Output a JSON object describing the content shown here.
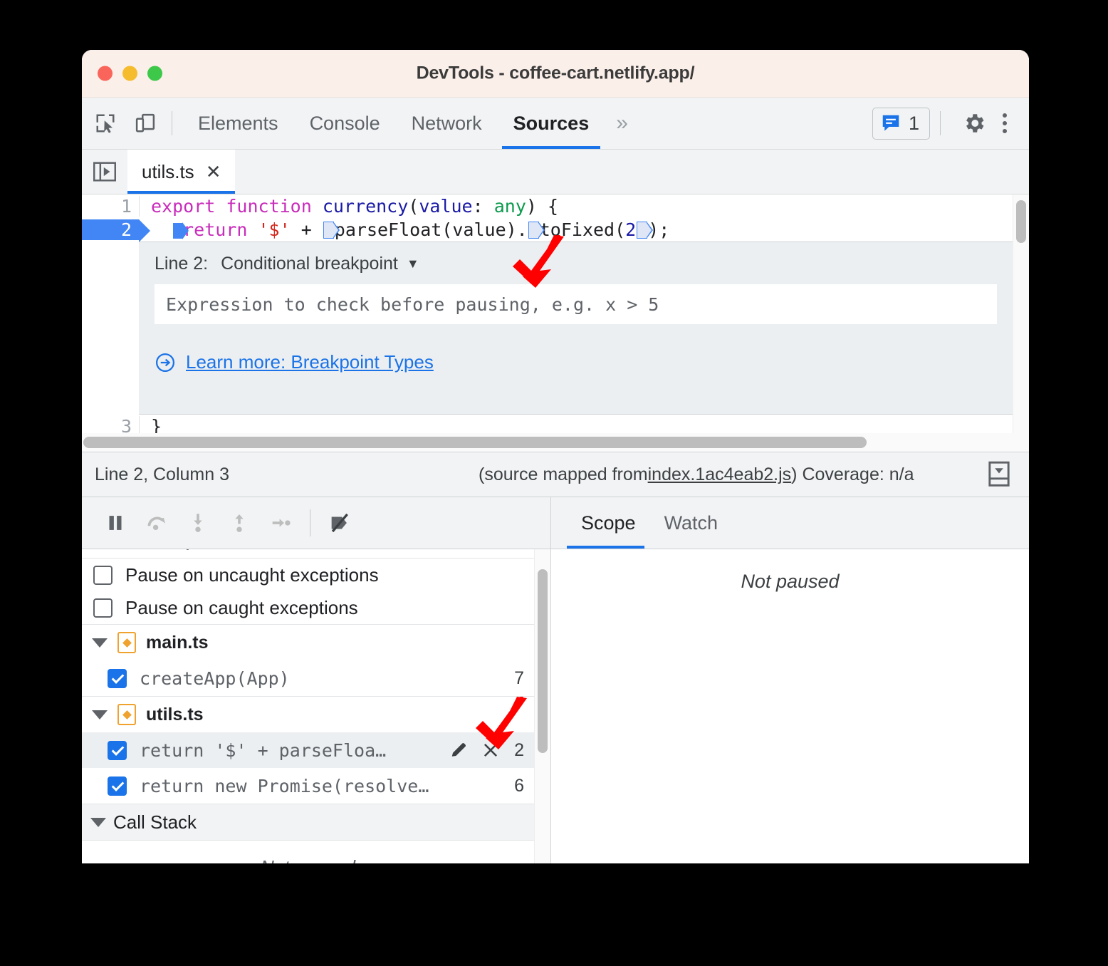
{
  "window": {
    "title": "DevTools - coffee-cart.netlify.app/",
    "traffic_lights": [
      "close",
      "minimize",
      "maximize"
    ]
  },
  "toolbar": {
    "inspect_icon": "inspect-element-icon",
    "device_icon": "device-toolbar-icon",
    "panels": [
      {
        "label": "Elements",
        "active": false
      },
      {
        "label": "Console",
        "active": false
      },
      {
        "label": "Network",
        "active": false
      },
      {
        "label": "Sources",
        "active": true
      }
    ],
    "more_panels": "»",
    "issues_count": "1",
    "issues_icon": "issues-message-icon",
    "settings_icon": "gear-icon",
    "kebab_icon": "more-options-icon"
  },
  "source_tabs": {
    "navigator_toggle_icon": "show-navigator-icon",
    "open_file": "utils.ts",
    "close_label": "✕"
  },
  "editor": {
    "lines": [
      {
        "number": "1",
        "breakpoint": false,
        "tokens": [
          {
            "t": "export",
            "c": "kw"
          },
          {
            "t": " ",
            "c": "plain"
          },
          {
            "t": "function",
            "c": "kw"
          },
          {
            "t": " ",
            "c": "plain"
          },
          {
            "t": "currency",
            "c": "fn"
          },
          {
            "t": "(",
            "c": "plain"
          },
          {
            "t": "value",
            "c": "param"
          },
          {
            "t": ": ",
            "c": "plain"
          },
          {
            "t": "any",
            "c": "type"
          },
          {
            "t": ") {",
            "c": "plain"
          }
        ]
      },
      {
        "number": "2",
        "breakpoint": true,
        "tokens": [
          {
            "t": "  ",
            "c": "plain"
          },
          {
            "t": "▸SOLID",
            "c": "bp-solid"
          },
          {
            "t": "return",
            "c": "kw"
          },
          {
            "t": " ",
            "c": "plain"
          },
          {
            "t": "'$'",
            "c": "str"
          },
          {
            "t": " + ",
            "c": "plain"
          },
          {
            "t": "▸HOLLOW",
            "c": "bp-hollow"
          },
          {
            "t": "parseFloat",
            "c": "plain"
          },
          {
            "t": "(value).",
            "c": "plain"
          },
          {
            "t": "▸HOLLOW",
            "c": "bp-hollow"
          },
          {
            "t": "toFixed",
            "c": "plain"
          },
          {
            "t": "(",
            "c": "plain"
          },
          {
            "t": "2",
            "c": "num"
          },
          {
            "t": "▸HOLLOW",
            "c": "bp-hollow"
          },
          {
            "t": ");",
            "c": "plain"
          }
        ]
      },
      {
        "number": "3",
        "breakpoint": false,
        "tokens": [
          {
            "t": "}",
            "c": "plain"
          }
        ]
      }
    ]
  },
  "breakpoint_editor": {
    "line_label": "Line 2:",
    "type_label": "Conditional breakpoint",
    "type_caret": "▼",
    "input_placeholder": "Expression to check before pausing, e.g. x > 5",
    "input_value": "",
    "learn_more_icon": "external-link-arrow-icon",
    "learn_more_label": "Learn more: Breakpoint Types"
  },
  "statusbar": {
    "position": "Line 2, Column 3",
    "source_mapped_prefix": "(source mapped from ",
    "source_mapped_file": "index.1ac4eab2.js",
    "source_mapped_suffix": ")",
    "coverage": "Coverage: n/a",
    "drawer_icon": "show-drawer-icon"
  },
  "debug_toolbar": {
    "buttons": [
      {
        "name": "pause-script-execution",
        "icon": "pause-icon"
      },
      {
        "name": "step-over-next-function-call",
        "icon": "step-over-icon"
      },
      {
        "name": "step-into-next-function-call",
        "icon": "step-into-icon"
      },
      {
        "name": "step-out-of-current-function",
        "icon": "step-out-icon"
      },
      {
        "name": "step",
        "icon": "step-icon"
      },
      {
        "name": "deactivate-breakpoints",
        "icon": "deactivate-breakpoints-icon"
      }
    ]
  },
  "breakpoints_pane": {
    "pause_options": [
      {
        "label": "Pause on uncaught exceptions",
        "checked": false
      },
      {
        "label": "Pause on caught exceptions",
        "checked": false
      }
    ],
    "groups": [
      {
        "file": "main.ts",
        "expanded": true,
        "items": [
          {
            "snippet": "createApp(App)",
            "line": "7",
            "checked": true,
            "selected": false,
            "actions": []
          }
        ]
      },
      {
        "file": "utils.ts",
        "expanded": true,
        "items": [
          {
            "snippet": "return '$' + parseFloa…",
            "line": "2",
            "checked": true,
            "selected": true,
            "actions": [
              "edit-breakpoint-icon",
              "remove-breakpoint-icon"
            ]
          },
          {
            "snippet": "return new Promise(resolve…",
            "line": "6",
            "checked": true,
            "selected": false,
            "actions": []
          }
        ]
      }
    ],
    "call_stack": {
      "title": "Call Stack",
      "expanded": true,
      "empty_text": "Not paused"
    }
  },
  "scope_pane": {
    "tabs": [
      {
        "label": "Scope",
        "active": true
      },
      {
        "label": "Watch",
        "active": false
      }
    ],
    "empty_text": "Not paused"
  },
  "annotations": {
    "arrow_color": "#ff0000",
    "arrows": [
      {
        "name": "arrow-to-conditional-breakpoint-dropdown"
      },
      {
        "name": "arrow-to-breakpoint-row-actions"
      }
    ]
  }
}
